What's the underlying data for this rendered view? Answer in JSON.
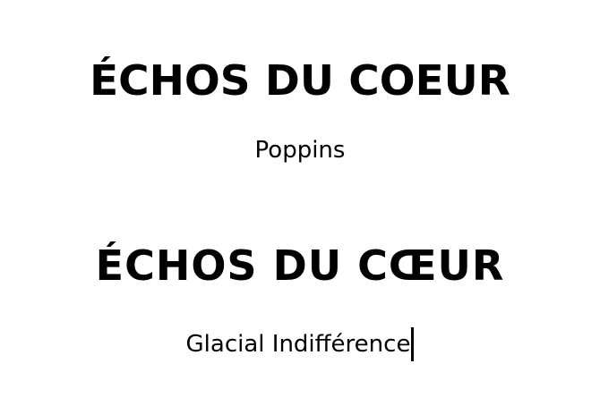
{
  "samples": [
    {
      "headline": "ÉCHOS DU COEUR",
      "font_label": "Poppins"
    },
    {
      "headline": "ÉCHOS DU CŒUR",
      "font_label": "Glacial Indifférence"
    }
  ],
  "colors": {
    "background": "#ffffff",
    "text": "#000000"
  }
}
